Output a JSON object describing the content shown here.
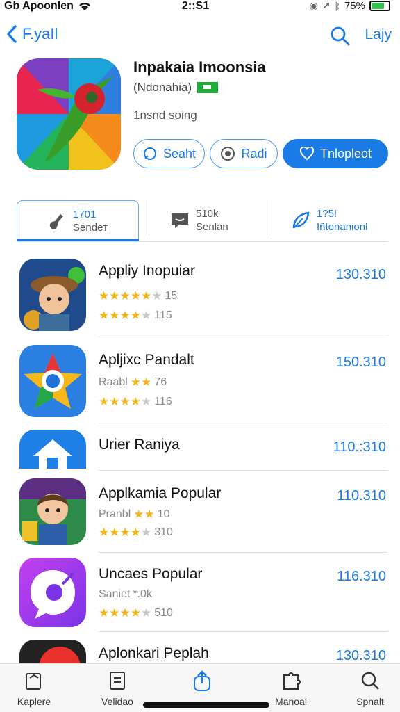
{
  "status": {
    "carrier": "Gb Apoonlen",
    "time": "2::S1",
    "battery": "75%",
    "battery_level": 0.75
  },
  "nav": {
    "back_label": "F.yaIl",
    "right_label": "Lajy"
  },
  "app": {
    "title": "Inpakaia Imoonsia",
    "subtitle": "(Ndonahia)",
    "meta": "1nsnd soing",
    "buttons": {
      "search": "Seaht",
      "read": "Radi",
      "install": "Tnlopleot"
    }
  },
  "stats": [
    {
      "value": "1701",
      "label": "Sendeт"
    },
    {
      "value": "510k",
      "label": "Senlan"
    },
    {
      "value": "1?5!",
      "label": "Iñtonanionl"
    }
  ],
  "apps": [
    {
      "title": "Appliy Inopuiar",
      "line2": "",
      "rating_a": 4.5,
      "count_a": "15",
      "rating_b": 4,
      "count_b": "115",
      "price": "130.310"
    },
    {
      "title": "Apljixc Pandalt",
      "line2": "Raabl",
      "rating_a": 2,
      "count_a": "76",
      "rating_b": 4,
      "count_b": "116",
      "price": "150.310"
    },
    {
      "title": "Urier Raniya",
      "line2": "",
      "price": "110.:310"
    },
    {
      "title": "Applkamia Popular",
      "line2": "Pranbl",
      "rating_a": 2,
      "count_a": "10",
      "rating_b": 4,
      "count_b": "310",
      "price": "110.310"
    },
    {
      "title": "Uncaes Popular",
      "line2": "Saniet",
      "count_a": "*.0k",
      "rating_b": 4,
      "count_b": "510",
      "price": "116.310"
    },
    {
      "title": "Aplonkari Peplah",
      "price": "130.310"
    }
  ],
  "tabs": [
    {
      "label": "Kaplere"
    },
    {
      "label": "Velidao"
    },
    {
      "label": ""
    },
    {
      "label": "Manoal"
    },
    {
      "label": "Spnalt"
    }
  ],
  "colors": {
    "accent": "#1a7be6",
    "star": "#f3b51a",
    "flag": "#1fae3a"
  }
}
